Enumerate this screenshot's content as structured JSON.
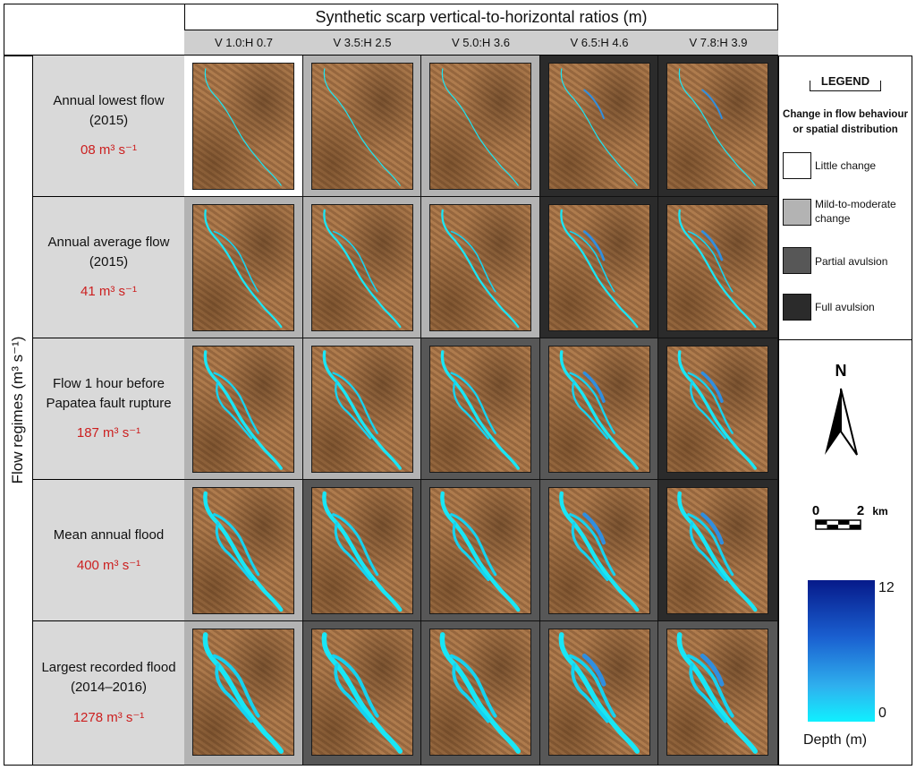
{
  "header": {
    "title": "Synthetic scarp vertical-to-horizontal ratios (m)",
    "columns": [
      "V 1.0:H 0.7",
      "V 3.5:H 2.5",
      "V 5.0:H 3.6",
      "V 6.5:H 4.6",
      "V 7.8:H 3.9"
    ]
  },
  "y_axis": {
    "label": "Flow regimes (m³ s⁻¹)"
  },
  "rows": [
    {
      "name_line1": "Annual lowest flow",
      "name_line2": "(2015)",
      "flow": "08 m³ s⁻¹"
    },
    {
      "name_line1": "Annual average flow",
      "name_line2": "(2015)",
      "flow": "41 m³ s⁻¹"
    },
    {
      "name_line1": "Flow 1 hour before",
      "name_line2": "Papatea fault rupture",
      "flow": "187 m³ s⁻¹"
    },
    {
      "name_line1": "Mean annual flood",
      "name_line2": "",
      "flow": "400 m³ s⁻¹"
    },
    {
      "name_line1": "Largest recorded flood",
      "name_line2": "(2014–2016)",
      "flow": "1278 m³ s⁻¹"
    }
  ],
  "grid_categories": [
    [
      "Little change",
      "Mild-to-moderate change",
      "Mild-to-moderate change",
      "Full avulsion",
      "Full avulsion"
    ],
    [
      "Mild-to-moderate change",
      "Mild-to-moderate change",
      "Mild-to-moderate change",
      "Full avulsion",
      "Full avulsion"
    ],
    [
      "Mild-to-moderate change",
      "Mild-to-moderate change",
      "Partial avulsion",
      "Partial avulsion",
      "Full avulsion"
    ],
    [
      "Mild-to-moderate change",
      "Partial avulsion",
      "Partial avulsion",
      "Partial avulsion",
      "Full avulsion"
    ],
    [
      "Mild-to-moderate change",
      "Partial avulsion",
      "Partial avulsion",
      "Partial avulsion",
      "Partial avulsion"
    ]
  ],
  "legend": {
    "title": "LEGEND",
    "subtitle_line1": "Change in flow behaviour",
    "subtitle_line2": "or spatial distribution",
    "items": [
      {
        "label": "Little change",
        "color": "#ffffff"
      },
      {
        "label_line1": "Mild-to-moderate",
        "label_line2": "change",
        "label": "Mild-to-moderate change",
        "color": "#b3b3b3"
      },
      {
        "label": "Partial avulsion",
        "color": "#575757"
      },
      {
        "label": "Full avulsion",
        "color": "#2b2b2b"
      }
    ]
  },
  "north_arrow": {
    "label": "N"
  },
  "scale_bar": {
    "start": "0",
    "end": "2",
    "unit": "km"
  },
  "depth_scale": {
    "max": "12",
    "min": "0",
    "title": "Depth (m)"
  },
  "colors": {
    "flow_red": "#cc1f1f",
    "terrain": "#a9764a",
    "water_shallow": "#10f0ff",
    "water_deep": "#061a8a"
  }
}
